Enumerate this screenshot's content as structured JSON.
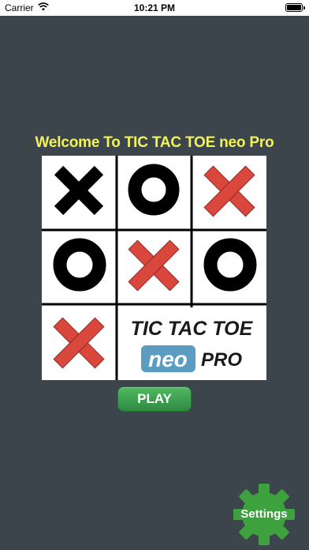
{
  "status_bar": {
    "carrier": "Carrier",
    "time": "10:21 PM"
  },
  "welcome_text": "Welcome To TIC TAC TOE neo Pro",
  "logo": {
    "line1": "TIC TAC TOE",
    "neo": "neo",
    "pro": "PRO"
  },
  "board": {
    "cells": [
      "X-black",
      "O",
      "X-red",
      "O",
      "X-red",
      "O",
      "X-red",
      "logo",
      "logo"
    ]
  },
  "play_label": "PLAY",
  "settings_label": "Settings",
  "colors": {
    "background": "#3c454b",
    "welcome_text": "#f2f25a",
    "red_x": "#d9473d",
    "black_mark": "#000000",
    "play_button": "#3a9e4d",
    "settings_gear": "#3da23e",
    "neo_badge": "#5b9cc0"
  },
  "icons": {
    "wifi": "wifi-icon",
    "battery": "battery-icon",
    "settings": "gear-icon"
  }
}
